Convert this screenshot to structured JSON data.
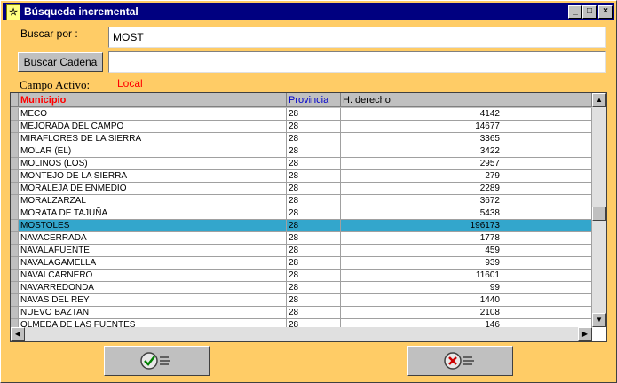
{
  "window": {
    "title": "Búsqueda incremental"
  },
  "titlebar": {
    "min": "_",
    "max": "□",
    "close": "×"
  },
  "search": {
    "label": "Buscar por :",
    "value": "MOST",
    "button": "Buscar Cadena",
    "string_value": ""
  },
  "active_field": {
    "label": "Campo Activo:",
    "value": "Local"
  },
  "table": {
    "columns": [
      "Municipio",
      "Provincia",
      "H. derecho",
      ""
    ],
    "rows": [
      [
        "MECO",
        "28",
        "4142"
      ],
      [
        "MEJORADA DEL CAMPO",
        "28",
        "14677"
      ],
      [
        "MIRAFLORES DE LA SIERRA",
        "28",
        "3365"
      ],
      [
        "MOLAR (EL)",
        "28",
        "3422"
      ],
      [
        "MOLINOS (LOS)",
        "28",
        "2957"
      ],
      [
        "MONTEJO DE LA SIERRA",
        "28",
        "279"
      ],
      [
        "MORALEJA DE ENMEDIO",
        "28",
        "2289"
      ],
      [
        "MORALZARZAL",
        "28",
        "3672"
      ],
      [
        "MORATA DE TAJUÑA",
        "28",
        "5438"
      ],
      [
        "MOSTOLES",
        "28",
        "196173"
      ],
      [
        "NAVACERRADA",
        "28",
        "1778"
      ],
      [
        "NAVALAFUENTE",
        "28",
        "459"
      ],
      [
        "NAVALAGAMELLA",
        "28",
        "939"
      ],
      [
        "NAVALCARNERO",
        "28",
        "11601"
      ],
      [
        "NAVARREDONDA",
        "28",
        "99"
      ],
      [
        "NAVAS DEL REY",
        "28",
        "1440"
      ],
      [
        "NUEVO BAZTAN",
        "28",
        "2108"
      ],
      [
        "OLMEDA DE LAS FUENTES",
        "28",
        "146"
      ]
    ],
    "selected_row": 9
  },
  "colors": {
    "accent": "#ff0000",
    "selection": "#33a6cc",
    "background": "#ffcc66",
    "title": "#000080"
  },
  "buttons": {
    "ok_icon": "checkmark-icon",
    "cancel_icon": "cancel-x-icon"
  }
}
